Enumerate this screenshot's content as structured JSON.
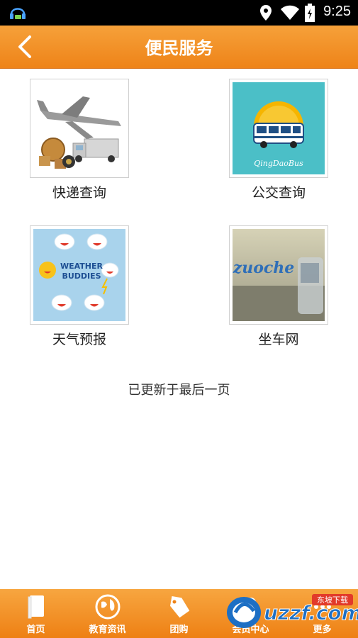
{
  "status_bar": {
    "time": "9:25"
  },
  "app_bar": {
    "title": "便民服务"
  },
  "tiles": [
    {
      "label": "快递查询",
      "icon": "airplane-truck-image"
    },
    {
      "label": "公交查询",
      "icon": "bus-image",
      "image_text": "QingDaoBus"
    },
    {
      "label": "天气预报",
      "icon": "weather-buddies-image",
      "image_text_1": "WEATHER",
      "image_text_2": "BUDDIES"
    },
    {
      "label": "坐车网",
      "icon": "zuoche-image",
      "image_text": "zuoche"
    }
  ],
  "footer_note": "已更新于最后一页",
  "tab_bar": {
    "items": [
      {
        "label": "首页",
        "icon": "book-icon"
      },
      {
        "label": "教育资讯",
        "icon": "globe-icon"
      },
      {
        "label": "团购",
        "icon": "sale-tag-icon"
      },
      {
        "label": "会员中心",
        "icon": "user-icon"
      },
      {
        "label": "更多",
        "icon": "more-icon"
      }
    ]
  },
  "watermark": {
    "brand": "uzzf.com",
    "tag": "东坡下载"
  }
}
